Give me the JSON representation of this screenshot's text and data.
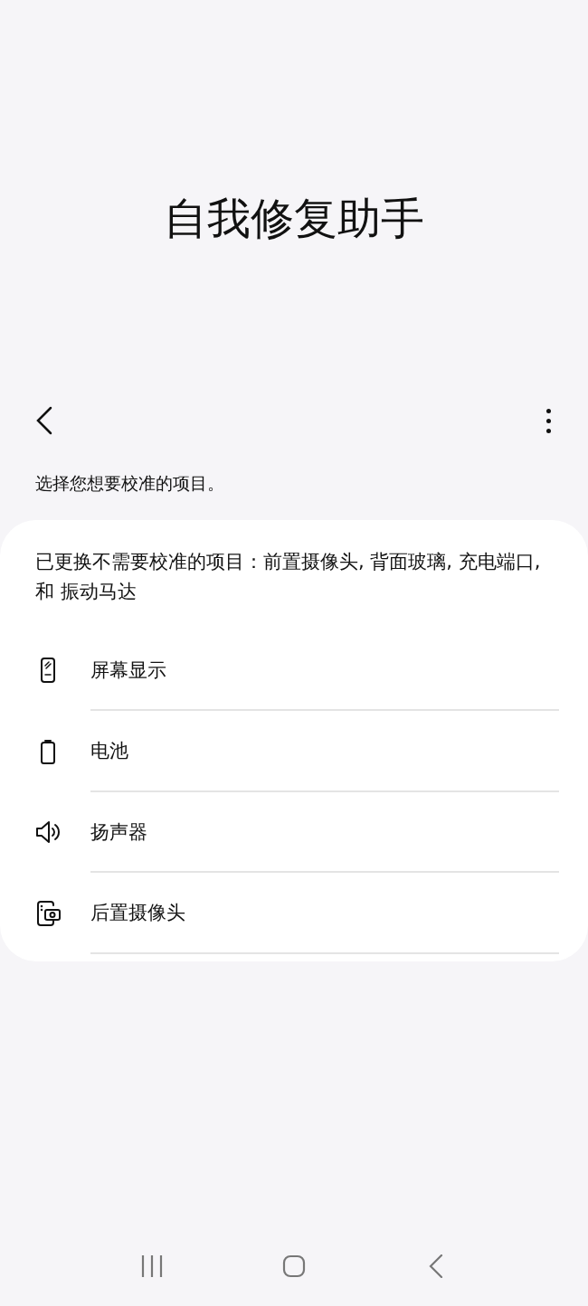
{
  "title": "自我修复助手",
  "instruction": "选择您想要校准的项目。",
  "card": {
    "note": "已更换不需要校准的项目：前置摄像头, 背面玻璃, 充电端口, 和 振动马达",
    "items": [
      {
        "kind": "display",
        "label": "屏幕显示"
      },
      {
        "kind": "battery",
        "label": "电池"
      },
      {
        "kind": "speaker",
        "label": "扬声器"
      },
      {
        "kind": "camera",
        "label": "后置摄像头"
      }
    ]
  }
}
